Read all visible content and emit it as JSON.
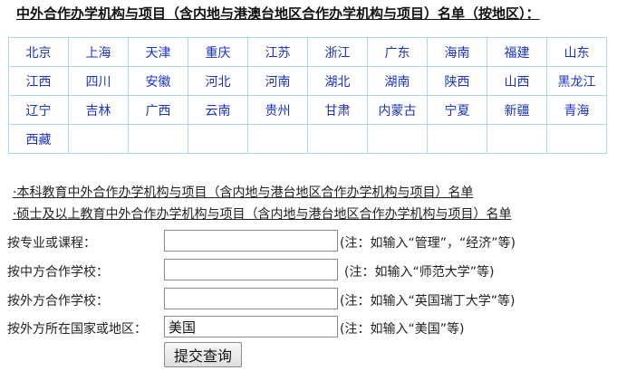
{
  "title": "中外合作办学机构与项目（含内地与港澳台地区合作办学机构与项目）名单（按地区）：",
  "regions": [
    [
      "北京",
      "上海",
      "天津",
      "重庆",
      "江苏",
      "浙江",
      "广东",
      "海南",
      "福建",
      "山东"
    ],
    [
      "江西",
      "四川",
      "安徽",
      "河北",
      "河南",
      "湖北",
      "湖南",
      "陕西",
      "山西",
      "黑龙江"
    ],
    [
      "辽宁",
      "吉林",
      "广西",
      "云南",
      "贵州",
      "甘肃",
      "内蒙古",
      "宁夏",
      "新疆",
      "青海"
    ],
    [
      "西藏",
      "",
      "",
      "",
      "",
      "",
      "",
      "",
      "",
      ""
    ]
  ],
  "links": {
    "undergrad": "·本科教育中外合作办学机构与项目（含内地与港台地区合作办学机构与项目）名单",
    "graduate": "·硕士及以上教育中外合作办学机构与项目（含内地与港台地区合作办学机构与项目）名单"
  },
  "search": {
    "major_label": "按专业或课程：",
    "major_value": "",
    "major_note": "(注：如输入“管理”，“经济”等)",
    "chinese_label": "按中方合作学校：",
    "chinese_value": "",
    "chinese_note": "(注：如输入“师范大学”等)",
    "foreign_label": "按外方合作学校：",
    "foreign_value": "",
    "foreign_note": "(注：如输入“英国瑞丁大学”等)",
    "country_label": "按外方所在国家或地区：",
    "country_value": "美国",
    "country_note": "(注：如输入“美国”等)",
    "submit_label": "提交查询"
  },
  "colors": {
    "link_blue": "#1a33c9",
    "table_border": "#a9d8ee"
  }
}
